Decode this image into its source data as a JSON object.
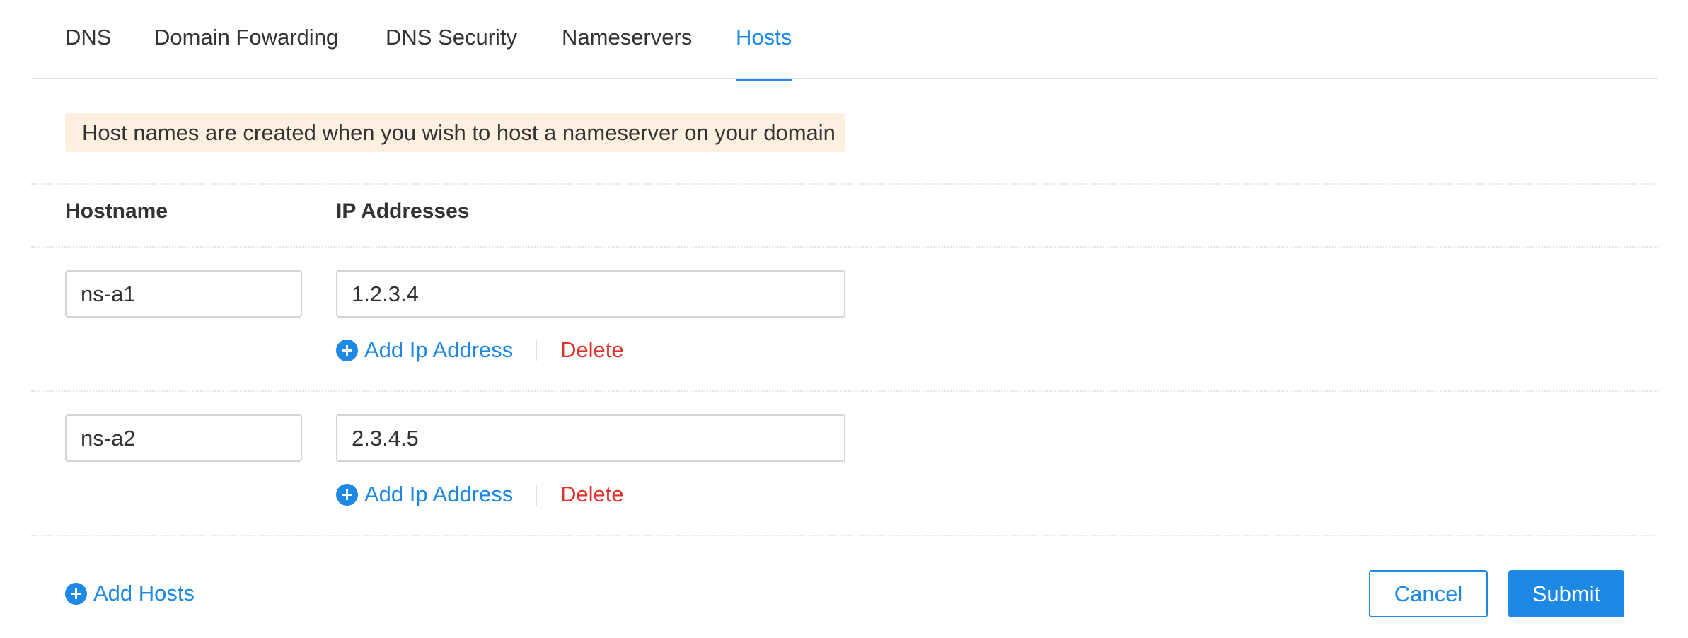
{
  "tabs": [
    {
      "label": "DNS"
    },
    {
      "label": "Domain Fowarding"
    },
    {
      "label": "DNS Security"
    },
    {
      "label": "Nameservers"
    },
    {
      "label": "Hosts",
      "active": true
    }
  ],
  "banner": {
    "text": "Host names are created when you wish to host a nameserver on your domain"
  },
  "table": {
    "headers": {
      "hostname": "Hostname",
      "ip": "IP Addresses"
    },
    "rows": [
      {
        "hostname": "ns-a1",
        "ip": "1.2.3.4",
        "add_ip_label": "Add Ip Address",
        "delete_label": "Delete"
      },
      {
        "hostname": "ns-a2",
        "ip": "2.3.4.5",
        "add_ip_label": "Add Ip Address",
        "delete_label": "Delete"
      }
    ]
  },
  "footer": {
    "add_hosts_label": "Add Hosts",
    "cancel_label": "Cancel",
    "submit_label": "Submit"
  },
  "colors": {
    "accent": "#1e88e5",
    "danger": "#e0312e",
    "banner_bg": "#fdf0e1"
  },
  "icons": {
    "add": "plus-circle-icon"
  }
}
